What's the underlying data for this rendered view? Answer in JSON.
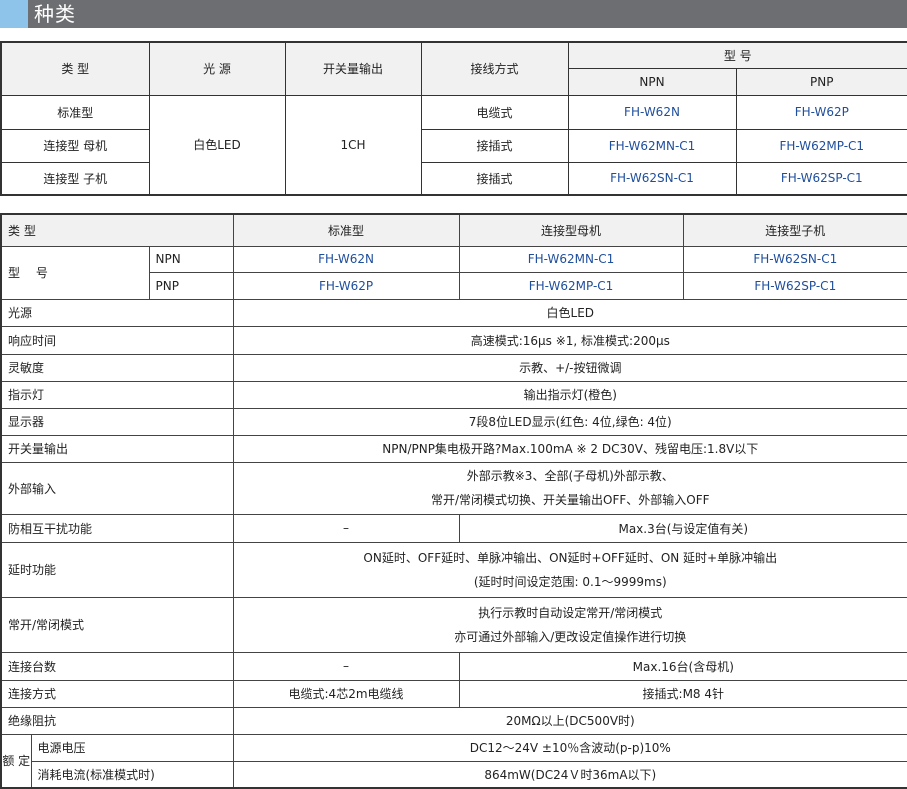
{
  "section_title": "种类",
  "t1": {
    "h_type": "类 型",
    "h_light": "光 源",
    "h_switch": "开关量输出",
    "h_conn": "接线方式",
    "h_model": "型 号",
    "h_npn": "NPN",
    "h_pnp": "PNP",
    "light": "白色LED",
    "output": "1CH",
    "rows": [
      {
        "type": "标准型",
        "conn": "电缆式",
        "npn": "FH-W62N",
        "pnp": "FH-W62P"
      },
      {
        "type": "连接型 母机",
        "conn": "接插式",
        "npn": "FH-W62MN-C1",
        "pnp": "FH-W62MP-C1"
      },
      {
        "type": "连接型 子机",
        "conn": "接插式",
        "npn": "FH-W62SN-C1",
        "pnp": "FH-W62SP-C1"
      }
    ]
  },
  "t2": {
    "h_type": "类 型",
    "h_std": "标准型",
    "h_master": "连接型母机",
    "h_slave": "连接型子机",
    "model_label": "型　 号",
    "npn": {
      "label": "NPN",
      "std": "FH-W62N",
      "master": "FH-W62MN-C1",
      "slave": "FH-W62SN-C1"
    },
    "pnp": {
      "label": "PNP",
      "std": "FH-W62P",
      "master": "FH-W62MP-C1",
      "slave": "FH-W62SP-C1"
    },
    "light": {
      "label": "光源",
      "value": "白色LED"
    },
    "resp": {
      "label": "响应时间",
      "value": "高速模式:16μs ※1, 标准模式:200μs"
    },
    "sens": {
      "label": "灵敏度",
      "value": "示教、+/-按钮微调"
    },
    "ind": {
      "label": "指示灯",
      "value": "输出指示灯(橙色)"
    },
    "disp": {
      "label": "显示器",
      "value": "7段8位LED显示(红色: 4位,绿色: 4位)"
    },
    "sw": {
      "label": "开关量输出",
      "value": "NPN/PNP集电极开路?Max.100mA ※ 2  DC30V、残留电压:1.8V以下"
    },
    "ext": {
      "label": "外部输入",
      "line1": "外部示教※3、全部(子母机)外部示教、",
      "line2": "常开/常闭模式切换、开关量输出OFF、外部输入OFF"
    },
    "anti": {
      "label": "防相互干扰功能",
      "left": "–",
      "right": "Max.3台(与设定值有关)"
    },
    "delay": {
      "label": "延时功能",
      "line1": "ON延时、OFF延时、单脉冲输出、ON延时+OFF延时、ON 延时+单脉冲输出",
      "line2": "(延时时间设定范围: 0.1～9999ms)"
    },
    "mode": {
      "label": "常开/常闭模式",
      "line1": "执行示教时自动设定常开/常闭模式",
      "line2": "亦可通过外部输入/更改设定值操作进行切换"
    },
    "count": {
      "label": "连接台数",
      "left": "–",
      "right": "Max.16台(含母机)"
    },
    "wiring": {
      "label": "连接方式",
      "left": "电缆式:4芯2m电缆线",
      "right": "接插式:M8 4针"
    },
    "ins": {
      "label": "绝缘阻抗",
      "value": "20MΩ以上(DC500V时)"
    },
    "rated_label": "额 定",
    "volt": {
      "label": "电源电压",
      "value": "DC12～24V ±10％含波动(p-p)10%"
    },
    "cur": {
      "label": "消耗电流(标准模式时)",
      "value": "864mW(DC24Ｖ时36mA以下)"
    }
  }
}
